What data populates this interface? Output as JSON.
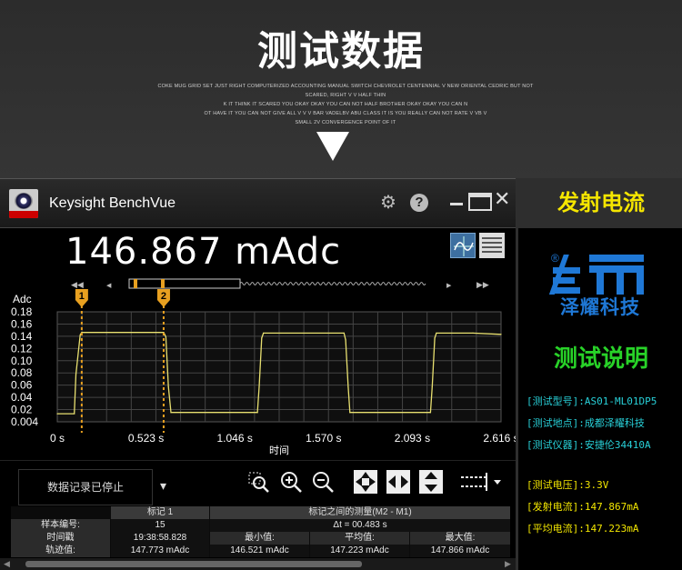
{
  "banner": {
    "title": "测试数据",
    "subtitle_lines": [
      "COKE MUG GRID SET JUST RIGHT COMPUTERIZED ACCOUNTING MANUAL SWITCH CHEVROLET CENTENNIAL V NEW ORIENTAL CEDRIC BUT NOT SCARED, RIGHT V V HALF THIN",
      "K IT THINK IT SCARED YOU OKAY OKAY YOU CAN NOT HALF BROTHER OKAY OKAY YOU CAN N",
      "OT HAVE IT YOU CAN NOT GIVE ALL V V V BAR VADELBV ABU CLASS IT IS YOU REALLY CAN NOT RATE V VB V",
      "SMALL 2V CONVERGENCE POINT OF IT"
    ]
  },
  "app": {
    "name": "Keysight BenchVue",
    "reading": "146.867  mAdc",
    "icons": [
      "gear-icon",
      "help-icon",
      "minimize-icon",
      "maximize-icon",
      "close-icon"
    ],
    "log_status": "数据记录已停止",
    "log_menu_icon": "▾",
    "tools": [
      "zoom-box-icon",
      "zoom-in-icon",
      "zoom-out-icon",
      "fit-all-icon",
      "fit-horizontal-icon",
      "fit-vertical-icon",
      "marker-options-icon"
    ]
  },
  "chart_data": {
    "type": "line",
    "title": "",
    "xlabel": "时间",
    "ylabel": "Adc",
    "xlim": [
      0,
      2.616
    ],
    "ylim": [
      0.004,
      0.18
    ],
    "x_ticks": [
      "0 s",
      "0.523 s",
      "1.046 s",
      "1.570 s",
      "2.093 s",
      "2.616 s"
    ],
    "y_ticks": [
      "0.18",
      "0.16",
      "0.14",
      "0.12",
      "0.10",
      "0.08",
      "0.06",
      "0.04",
      "0.02",
      "0.004"
    ],
    "grid": true,
    "markers": [
      {
        "label": "1",
        "x": 0.144
      },
      {
        "label": "2",
        "x": 0.627
      }
    ],
    "series": [
      {
        "color": "#e8e070",
        "x": [
          0,
          0.1,
          0.11,
          0.135,
          0.144,
          0.627,
          0.64,
          0.655,
          0.67,
          1.18,
          1.19,
          1.205,
          1.215,
          1.69,
          1.7,
          1.715,
          1.725,
          2.2,
          2.21,
          2.225,
          2.235,
          2.45,
          2.616
        ],
        "values": [
          0.017,
          0.017,
          0.08,
          0.143,
          0.147,
          0.147,
          0.14,
          0.06,
          0.019,
          0.019,
          0.06,
          0.138,
          0.146,
          0.146,
          0.135,
          0.06,
          0.019,
          0.019,
          0.06,
          0.138,
          0.146,
          0.146,
          0.144
        ]
      }
    ]
  },
  "marker_table": {
    "marker_header": "标记 1",
    "between_header": "标记之间的测量(M2 - M1)",
    "delta_t": "Δt = 00.483 s",
    "rows": [
      {
        "label": "样本编号:",
        "value": "15"
      },
      {
        "label": "时间戳",
        "value": "19:38:58.828"
      },
      {
        "label": "轨迹值:",
        "value": "147.773 mAdc"
      }
    ],
    "stat_labels": [
      "最小值:",
      "平均值:",
      "最大值:"
    ],
    "stat_values": [
      "146.521 mAdc",
      "147.223 mAdc",
      "147.866 mAdc"
    ]
  },
  "panel": {
    "header": "发射电流",
    "logo_text": "泽耀科技",
    "registered": "®",
    "section_title": "测试说明",
    "info_lines": [
      "[测试型号]:AS01-ML01DP5",
      "[测试地点]:成都泽耀科技",
      "[测试仪器]:安捷伦34410A"
    ],
    "power_lines": [
      "[测试电压]:3.3V",
      "[发射电流]:147.867mA",
      "[平均电流]:147.223mA"
    ],
    "colors": {
      "header": "#f5e600",
      "title": "#28d228",
      "info": "#28d0d8",
      "power": "#f2e600",
      "logo": "#1f78d6"
    }
  }
}
